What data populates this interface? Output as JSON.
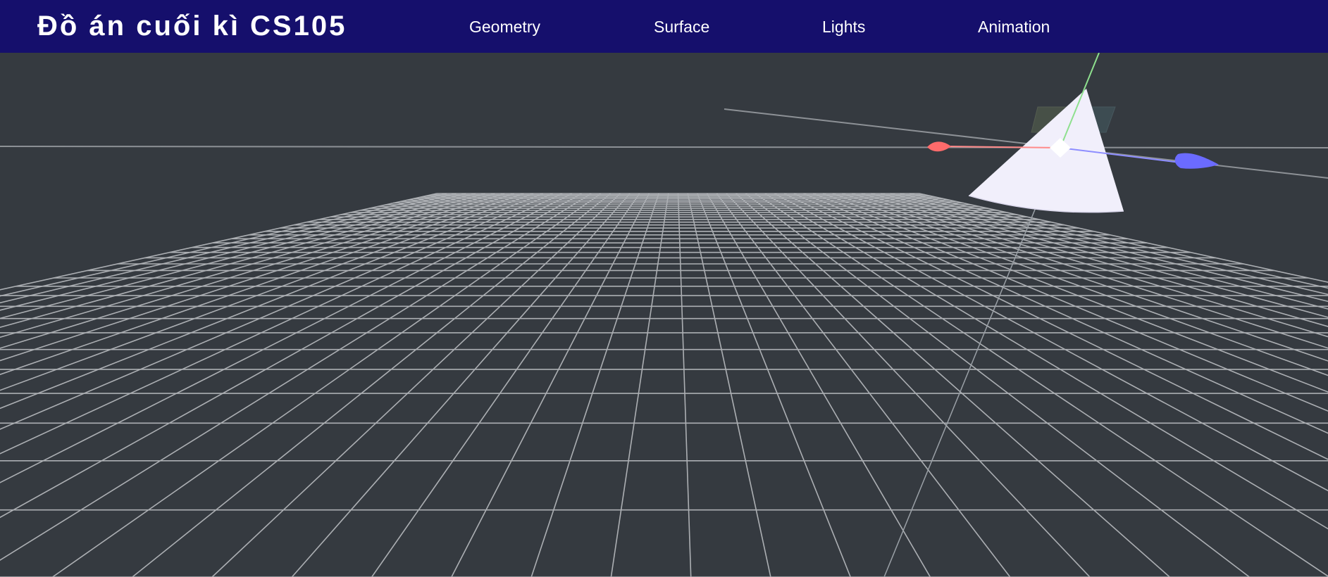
{
  "header": {
    "title": "Đồ án cuối kì CS105",
    "nav": [
      {
        "label": "Geometry"
      },
      {
        "label": "Surface"
      },
      {
        "label": "Lights"
      },
      {
        "label": "Animation"
      }
    ]
  },
  "scene": {
    "background_color": "#353a40",
    "navbar_color": "#150f6c",
    "grid_color": "#b9bcc0",
    "object": "cone",
    "object_color": "#f1effb",
    "gizmo_colors": {
      "x": "#ff6b6b",
      "y": "#7de07d",
      "z": "#6b6bff"
    }
  }
}
